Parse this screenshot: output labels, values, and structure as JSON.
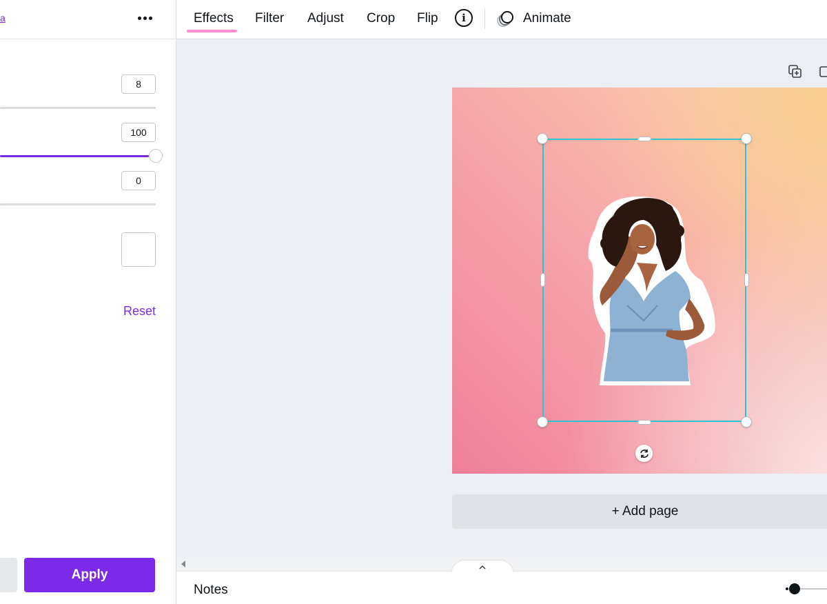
{
  "left_panel": {
    "partial_link": "a",
    "more_icon": "more-horizontal-icon",
    "sliders": [
      {
        "value": "8",
        "level": 0.0
      },
      {
        "value": "100",
        "level": 1.0
      },
      {
        "value": "0",
        "level": 0.0
      }
    ],
    "reset_label": "Reset",
    "apply_label": "Apply"
  },
  "toolbar": {
    "tabs": [
      "Effects",
      "Filter",
      "Adjust",
      "Crop",
      "Flip"
    ],
    "active_tab": "Effects",
    "info_icon": "info-icon",
    "info_glyph": "i",
    "animate_label": "Animate",
    "animate_icon": "animate-icon"
  },
  "canvas": {
    "add_page_label": "+ Add page",
    "page_tool_icons": [
      "duplicate-page-icon",
      "add-page-icon"
    ],
    "rotate_icon": "rotate-icon"
  },
  "bottom": {
    "notes_label": "Notes",
    "collapse_icon": "chevron-up-icon"
  },
  "colors": {
    "accent": "#7d2ae8",
    "selection": "#29c5d3",
    "active_tab_underline": "#ff8ecf",
    "slider_fill": "#7d2ae8"
  }
}
